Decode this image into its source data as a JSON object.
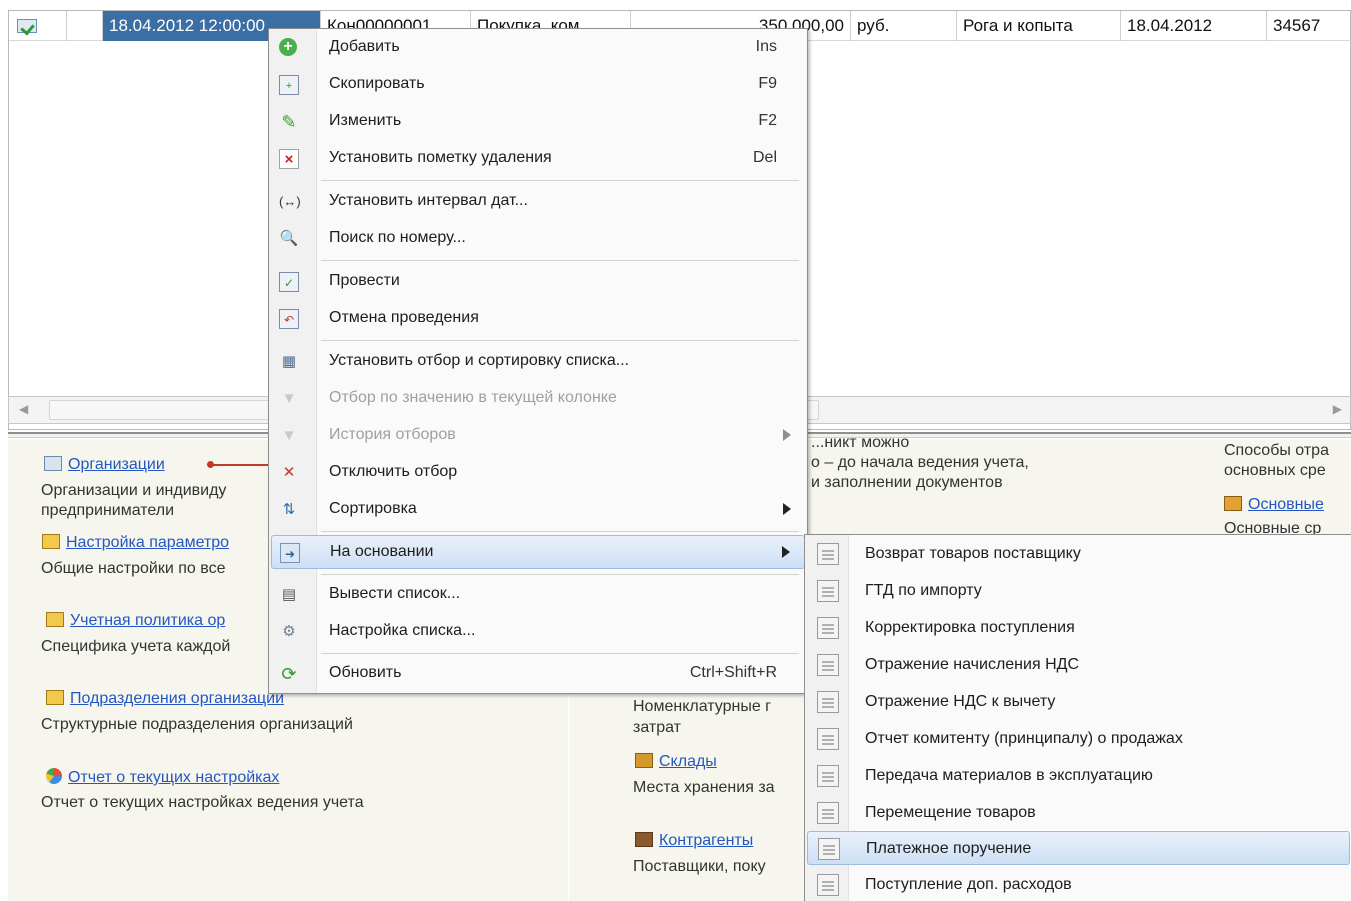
{
  "grid": {
    "row": {
      "date": "18.04.2012 12:00:00",
      "number": "Кон00000001",
      "operation": "Покупка, ком...",
      "amount": "350 000,00",
      "currency": "руб.",
      "counterparty": "Рога и копыта",
      "incoming_date": "18.04.2012",
      "incoming_number": "34567"
    }
  },
  "context_menu": {
    "items": [
      {
        "label": "Добавить",
        "shortcut": "Ins",
        "icon": "plus-circle-icon"
      },
      {
        "label": "Скопировать",
        "shortcut": "F9",
        "icon": "copy-icon"
      },
      {
        "label": "Изменить",
        "shortcut": "F2",
        "icon": "pencil-icon"
      },
      {
        "label": "Установить пометку удаления",
        "shortcut": "Del",
        "icon": "delete-mark-icon"
      },
      {
        "label": "Установить интервал дат...",
        "icon": "date-range-icon"
      },
      {
        "label": "Поиск по номеру...",
        "icon": "search-number-icon"
      },
      {
        "label": "Провести",
        "icon": "post-document-icon"
      },
      {
        "label": "Отмена проведения",
        "icon": "unpost-document-icon"
      },
      {
        "label": "Установить отбор и сортировку списка...",
        "icon": "filter-sort-icon"
      },
      {
        "label": "Отбор по значению в текущей колонке",
        "icon": "filter-value-icon",
        "disabled": true
      },
      {
        "label": "История отборов",
        "icon": "filter-history-icon",
        "disabled": true
      },
      {
        "label": "Отключить отбор",
        "icon": "filter-off-icon"
      },
      {
        "label": "Сортировка",
        "icon": "sort-icon"
      },
      {
        "label": "На основании",
        "icon": "based-on-icon"
      },
      {
        "label": "Вывести список...",
        "icon": "print-list-icon"
      },
      {
        "label": "Настройка списка...",
        "icon": "list-settings-icon"
      },
      {
        "label": "Обновить",
        "shortcut": "Ctrl+Shift+R",
        "icon": "refresh-icon"
      }
    ]
  },
  "submenu": {
    "items": [
      "Возврат товаров поставщику",
      "ГТД по импорту",
      "Корректировка поступления",
      "Отражение начисления НДС",
      "Отражение НДС к вычету",
      "Отчет комитенту (принципалу) о продажах",
      "Передача материалов в эксплуатацию",
      "Перемещение товаров",
      "Платежное поручение",
      "Поступление доп. расходов"
    ]
  },
  "bottom_panel": {
    "col1": {
      "organizations_link": "Организации",
      "organizations_desc_1": "Организации и индивиду",
      "organizations_desc_2": "предприниматели",
      "params_link": "Настройка параметро",
      "params_desc": "Общие настройки по все",
      "policy_link": "Учетная политика ор",
      "policy_desc": "Специфика учета каждой",
      "divisions_link": "Подразделения организаций",
      "divisions_desc": "Структурные подразделения организаций",
      "report_link": "Отчет о текущих настройках",
      "report_desc": "Отчет о текущих настройках ведения учета"
    },
    "col2": {
      "top_clip": "...никт можно",
      "line_1": "о – до начала ведения учета,",
      "line_2": "и заполнении документов",
      "nomenclature_desc_1": "Номенклатурные г",
      "nomenclature_desc_2": "затрат",
      "warehouses_link": "Склады",
      "warehouses_desc": "Места хранения за",
      "contractors_link": "Контрагенты",
      "contractors_desc": "Поставщики, поку"
    },
    "col3": {
      "line_1": "Способы отра",
      "line_2": "основных сре",
      "assets_link": "Основные",
      "assets_desc": "Основные ср"
    }
  }
}
